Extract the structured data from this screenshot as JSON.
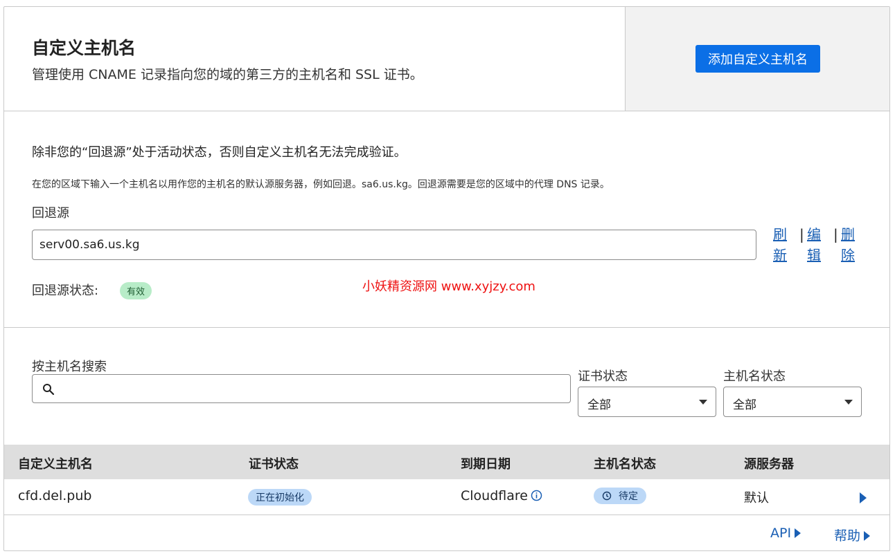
{
  "header": {
    "title": "自定义主机名",
    "subtitle": "管理使用 CNAME 记录指向您的域的第三方的主机名和 SSL 证书。",
    "add_button": "添加自定义主机名"
  },
  "fallback": {
    "warning": "除非您的“回退源”处于活动状态，否则自定义主机名无法完成验证。",
    "description": "在您的区域下输入一个主机名以用作您的主机名的默认源服务器，例如回退。sa6.us.kg。回退源需要是您的区域中的代理 DNS 记录。",
    "label": "回退源",
    "value": "serv00.sa6.us.kg",
    "actions": [
      {
        "top": "刷",
        "bottom": "新"
      },
      {
        "top": "编",
        "bottom": "辑"
      },
      {
        "top": "删",
        "bottom": "除"
      }
    ],
    "separator": "|",
    "status_label": "回退源状态:",
    "status_badge": "有效"
  },
  "watermark": "小妖精资源网 www.xyjzy.com",
  "search": {
    "label": "按主机名搜索",
    "value": "",
    "icon": "search-icon"
  },
  "filters": {
    "cert_status": {
      "label": "证书状态",
      "value": "全部"
    },
    "hostname_status": {
      "label": "主机名状态",
      "value": "全部"
    }
  },
  "table": {
    "columns": [
      "自定义主机名",
      "证书状态",
      "到期日期",
      "主机名状态",
      "源服务器"
    ],
    "rows": [
      {
        "hostname": "cfd.del.pub",
        "cert_status": "正在初始化",
        "expiry": "Cloudflare",
        "hostname_status": "待定",
        "origin": "默认"
      }
    ]
  },
  "footer": {
    "api": "API",
    "help": "帮助"
  },
  "colors": {
    "primary": "#0b6fe6",
    "link": "#1a5fb4",
    "success_badge": "#b8ecc8",
    "info_pill": "#bcd8f7",
    "watermark": "#ee1111"
  }
}
